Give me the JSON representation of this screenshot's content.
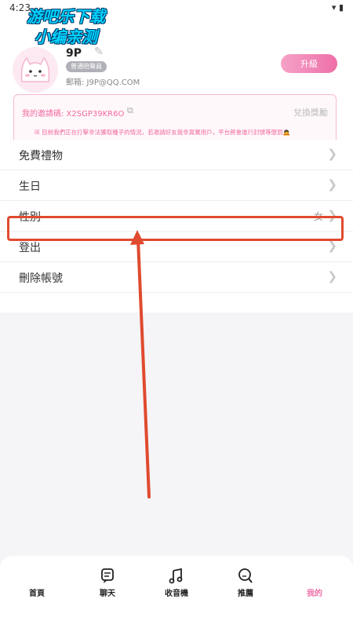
{
  "status": {
    "time": "4:23",
    "icons": "▾ ▮"
  },
  "watermark": {
    "line1": "游吧乐下载",
    "line2": "小编亲测"
  },
  "profile": {
    "name": "9P",
    "edit_icon": "pencil-icon",
    "badge": "普通陪聲員",
    "email": "郵箱: J9P@QQ.COM",
    "upgrade_label": "升級"
  },
  "invite": {
    "code_text": "我的邀請碼: X2SGP39KR6O",
    "copy_icon": "copy-icon",
    "redeem_label": "兌換獎勵",
    "note": "☒ 目前我們正在打擊非法獲取種子的情況，若邀請好友我非真實用戶，平台將會進行封號等懲罰🙇"
  },
  "menu": [
    {
      "label": "免費禮物",
      "value": ""
    },
    {
      "label": "生日",
      "value": ""
    },
    {
      "label": "性別",
      "value": "女"
    },
    {
      "label": "登出",
      "value": ""
    },
    {
      "label": "刪除帳號",
      "value": ""
    }
  ],
  "nav": [
    {
      "label": "首頁",
      "icon": "home-icon"
    },
    {
      "label": "聊天",
      "icon": "chat-icon"
    },
    {
      "label": "收音機",
      "icon": "music-icon"
    },
    {
      "label": "推薦",
      "icon": "search-icon"
    },
    {
      "label": "我的",
      "icon": "profile-icon",
      "active": true
    }
  ],
  "colors": {
    "accent": "#ef6fa8",
    "highlight": "#e04a2f"
  }
}
